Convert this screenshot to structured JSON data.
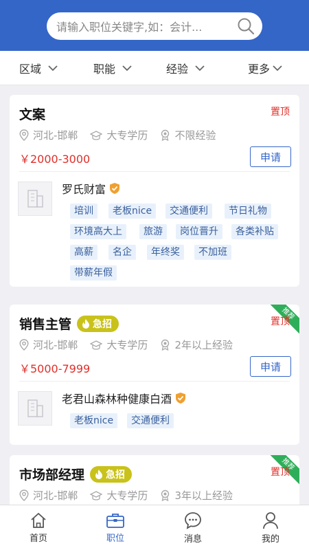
{
  "search": {
    "placeholder": "请输入职位关键字,如：会计..."
  },
  "filters": [
    {
      "label": "区域"
    },
    {
      "label": "职能"
    },
    {
      "label": "经验"
    },
    {
      "label": "更多"
    }
  ],
  "jobs": [
    {
      "title": "文案",
      "top_label": "置顶",
      "location": "河北-邯郸",
      "education": "大专学历",
      "experience": "不限经验",
      "salary": "￥2000-3000",
      "apply_label": "申请",
      "company": "罗氏财富",
      "tags": [
        "培训",
        "老板nice",
        "交通便利",
        "节日礼物",
        "环境高大上",
        "旅游",
        "岗位晋升",
        "各类补贴",
        "高薪",
        "名企",
        "年终奖",
        "不加班",
        "带薪年假"
      ]
    },
    {
      "title": "销售主管",
      "urgent_label": "急招",
      "ribbon_label": "推荐",
      "top_label": "置顶",
      "location": "河北-邯郸",
      "education": "大专学历",
      "experience": "2年以上经验",
      "salary": "￥5000-7999",
      "apply_label": "申请",
      "company": "老君山森林种健康白酒",
      "tags": [
        "老板nice",
        "交通便利"
      ]
    },
    {
      "title": "市场部经理",
      "urgent_label": "急招",
      "ribbon_label": "推荐",
      "top_label": "置顶",
      "location": "河北-邯郸",
      "education": "大专学历",
      "experience": "3年以上经验"
    }
  ],
  "nav": [
    {
      "label": "首页",
      "icon": "home-icon"
    },
    {
      "label": "职位",
      "icon": "briefcase-icon",
      "active": true
    },
    {
      "label": "消息",
      "icon": "message-icon"
    },
    {
      "label": "我的",
      "icon": "user-icon"
    }
  ],
  "colors": {
    "brand": "#3466c8",
    "salary": "#e0302a",
    "urgent": "#c9c21a",
    "ribbon": "#2fae5a"
  }
}
